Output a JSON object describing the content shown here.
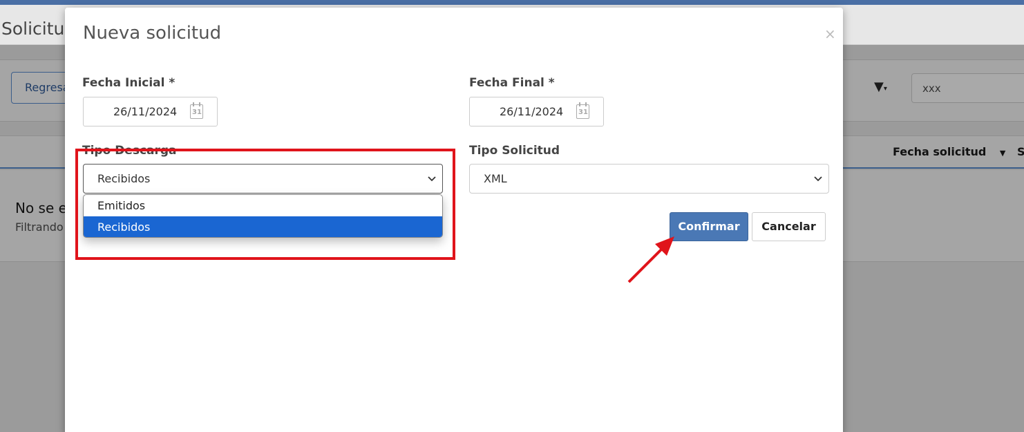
{
  "background": {
    "page_title": "Solicitu",
    "back_button": "Regresa",
    "filter_icon": "filter-icon",
    "search_value": "xxx",
    "column_header": "Fecha solicitud",
    "column_header_next": "S",
    "empty_title": "No se e",
    "empty_subtitle": "Filtrando"
  },
  "modal": {
    "title": "Nueva solicitud",
    "close_glyph": "×",
    "fecha_inicial_label": "Fecha Inicial *",
    "fecha_inicial_value": "26/11/2024",
    "fecha_final_label": "Fecha Final *",
    "fecha_final_value": "26/11/2024",
    "calendar_glyph": "31",
    "tipo_descarga_label": "Tipo Descarga",
    "tipo_descarga_value": "Recibidos",
    "tipo_descarga_options": [
      "Emitidos",
      "Recibidos"
    ],
    "tipo_solicitud_label": "Tipo Solicitud",
    "tipo_solicitud_value": "XML",
    "confirm_label": "Confirmar",
    "cancel_label": "Cancelar"
  },
  "colors": {
    "primary": "#4a78b5",
    "selected_option": "#1a66d2",
    "annotation_red": "#e0141b"
  }
}
